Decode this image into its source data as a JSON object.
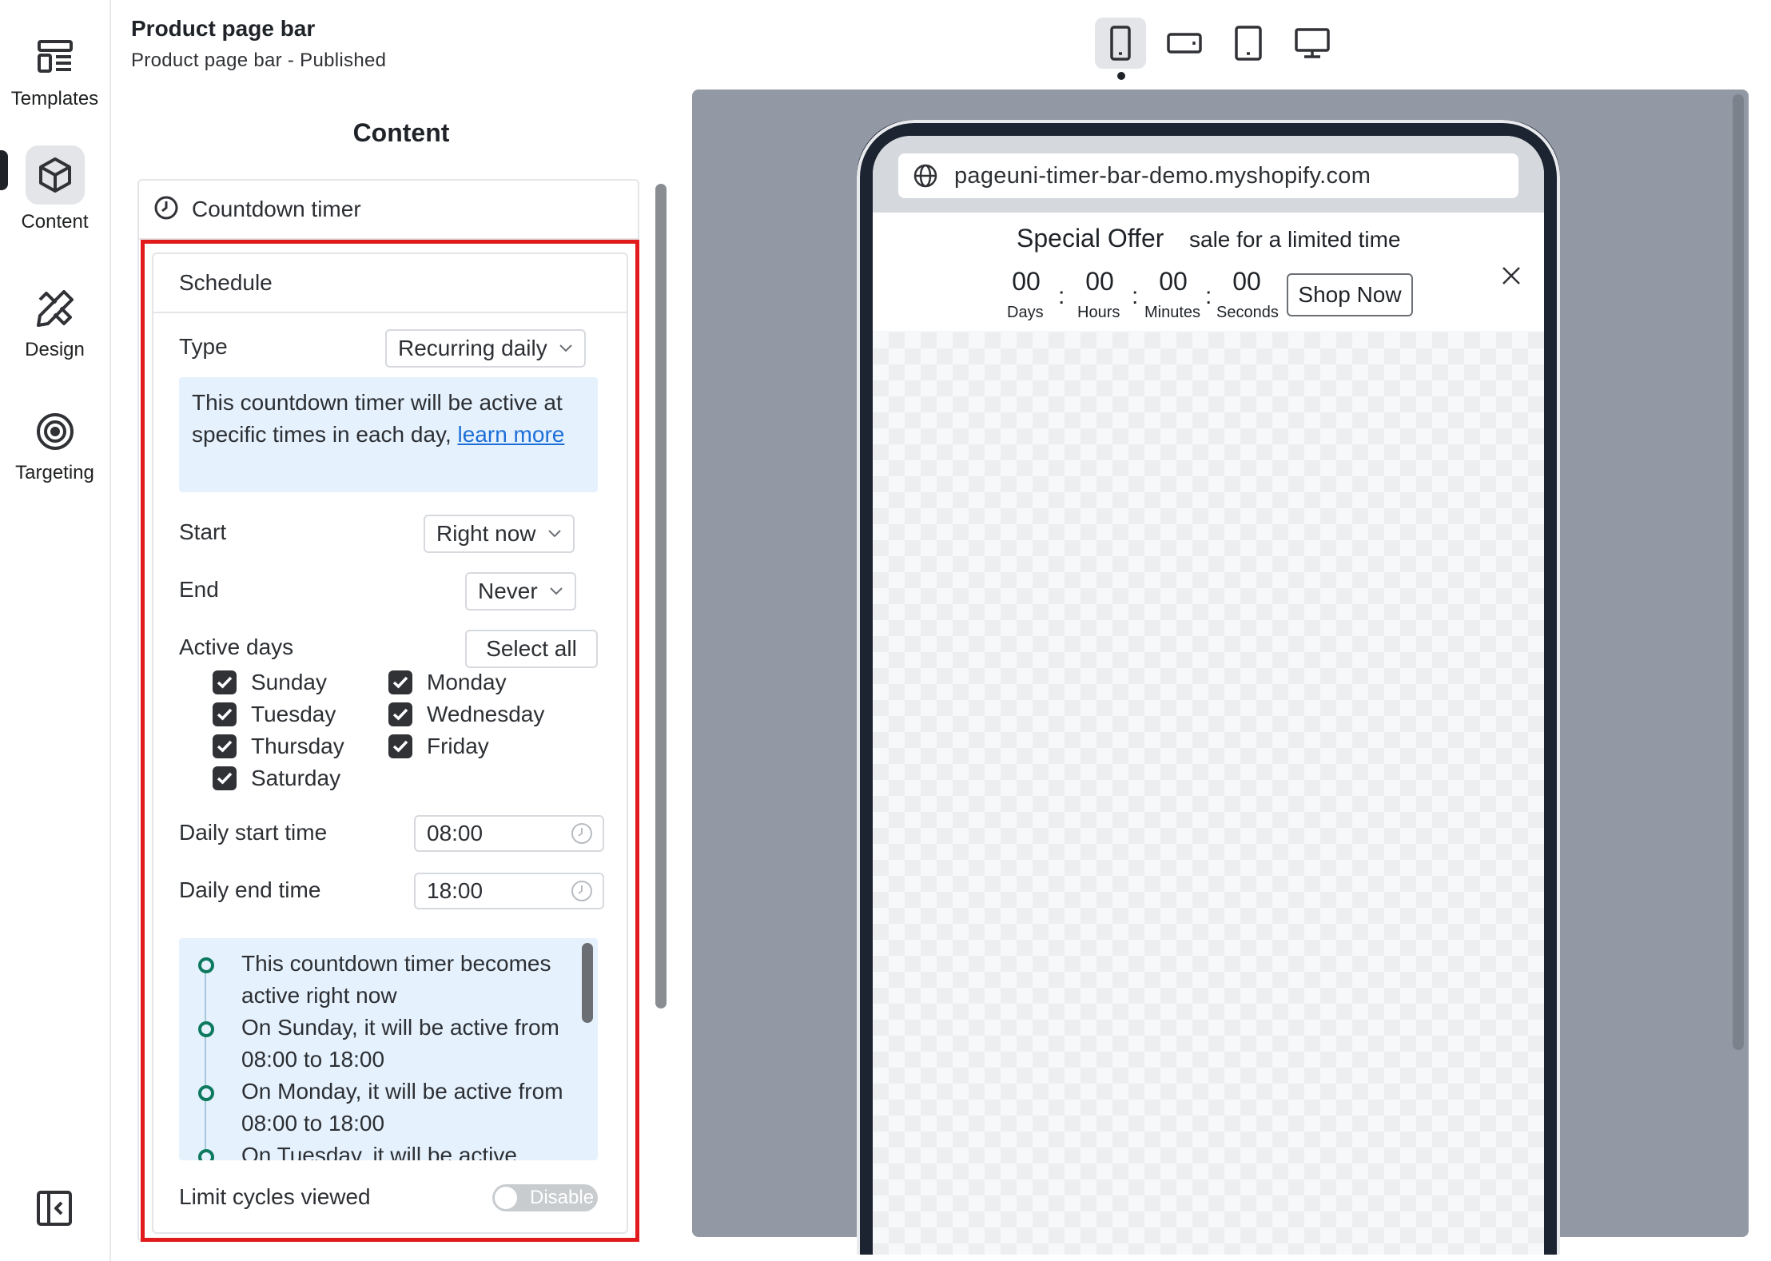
{
  "header": {
    "title": "Product page bar",
    "subtitle": "Product page bar - Published"
  },
  "rail": {
    "items": [
      {
        "label": "Templates",
        "icon": "templates-icon"
      },
      {
        "label": "Content",
        "icon": "cube-icon",
        "active": true
      },
      {
        "label": "Design",
        "icon": "design-tools-icon"
      },
      {
        "label": "Targeting",
        "icon": "target-icon"
      }
    ],
    "collapse_icon": "collapse-sidebar-icon"
  },
  "devices": {
    "items": [
      "mobile-portrait-icon",
      "mobile-landscape-icon",
      "tablet-icon",
      "desktop-icon"
    ],
    "active": "mobile-portrait-icon"
  },
  "panel": {
    "heading": "Content",
    "section": "Countdown timer",
    "schedule": {
      "title": "Schedule",
      "type_label": "Type",
      "type_value": "Recurring daily",
      "info_text": "This countdown timer will be active at specific times in each day, ",
      "info_link": "learn more",
      "start_label": "Start",
      "start_value": "Right now",
      "end_label": "End",
      "end_value": "Never",
      "active_days_label": "Active days",
      "select_all": "Select all",
      "days": [
        "Sunday",
        "Monday",
        "Tuesday",
        "Wednesday",
        "Thursday",
        "Friday",
        "Saturday"
      ],
      "daily_start_label": "Daily start time",
      "daily_start_value": "08:00",
      "daily_end_label": "Daily end time",
      "daily_end_value": "18:00",
      "timeline": [
        "This countdown timer becomes active right now",
        "On Sunday, it will be active from 08:00 to 18:00",
        "On Monday, it will be active from 08:00 to 18:00",
        "On Tuesday, it will be active"
      ],
      "limit_label": "Limit cycles viewed",
      "limit_toggle": "Disable"
    }
  },
  "preview": {
    "url": "pageuni-timer-bar-demo.myshopify.com",
    "offer_title": "Special Offer",
    "offer_sub": "sale for a limited time",
    "countdown": [
      {
        "value": "00",
        "label": "Days"
      },
      {
        "value": "00",
        "label": "Hours"
      },
      {
        "value": "00",
        "label": "Minutes"
      },
      {
        "value": "00",
        "label": "Seconds"
      }
    ],
    "shop_button": "Shop Now"
  },
  "colors": {
    "highlight": "#e11b1b",
    "info_bg": "#e5f1fd",
    "link": "#1d6fd8",
    "timeline_dot": "#0d7a5f",
    "preview_bg": "#9299a4"
  }
}
